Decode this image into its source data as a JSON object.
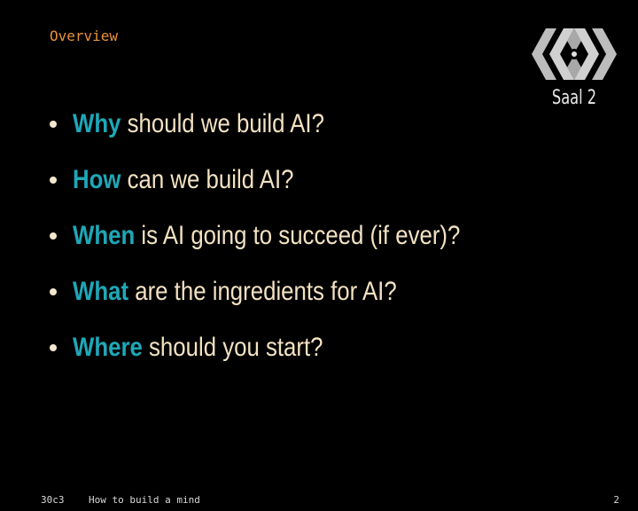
{
  "slide": {
    "section_title": "Overview",
    "room_label": "Saal 2",
    "bullets": [
      {
        "keyword": "Why",
        "rest": " should we build AI?"
      },
      {
        "keyword": "How",
        "rest": " can we build AI?"
      },
      {
        "keyword": "When",
        "rest": " is AI going to succeed (if ever)?"
      },
      {
        "keyword": "What",
        "rest": " are the ingredients for AI?"
      },
      {
        "keyword": "Where",
        "rest": " should you start?"
      }
    ],
    "footer": {
      "event": "30c3",
      "talk_title": "How to build a mind",
      "page_number": "2"
    }
  },
  "colors": {
    "background": "#000000",
    "section_title": "#e8923a",
    "keyword": "#1ea8b8",
    "body_text": "#f3e2c2"
  },
  "icons": {
    "logo": "ccc-30c3-logo-icon"
  }
}
